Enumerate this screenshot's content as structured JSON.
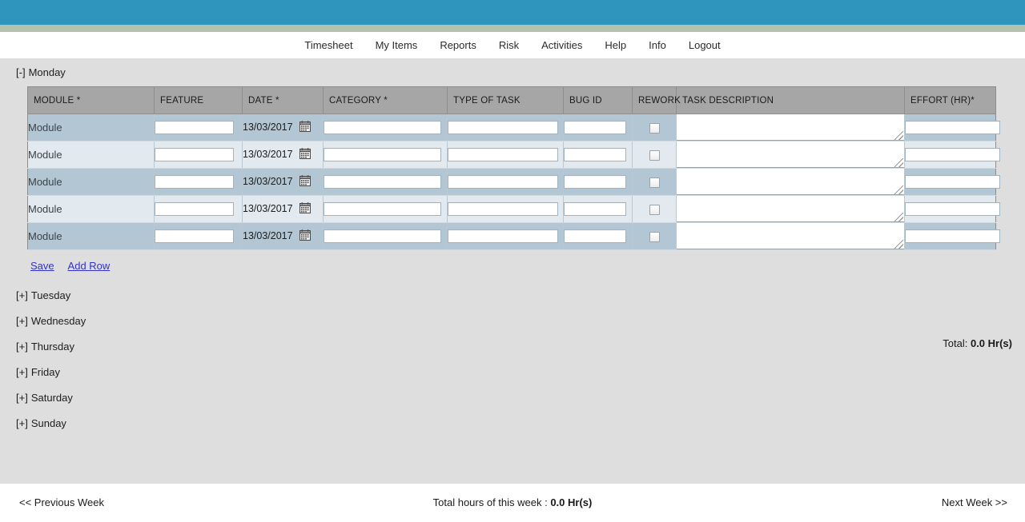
{
  "theme": {
    "banner_color": "#2f95bd",
    "banner_strip_color": "#b4c2ae",
    "content_bg": "#dedede",
    "header_row_bg": "#a6a6a6",
    "row_odd_bg": "#b3c6d3",
    "row_even_bg": "#e2eaef",
    "link_color": "#3232c8"
  },
  "nav": {
    "items": [
      {
        "label": "Timesheet"
      },
      {
        "label": "My Items"
      },
      {
        "label": "Reports"
      },
      {
        "label": "Risk"
      },
      {
        "label": "Activities"
      },
      {
        "label": "Help"
      },
      {
        "label": "Info"
      },
      {
        "label": "Logout"
      }
    ]
  },
  "expanded_day": {
    "toggle": "[-]",
    "label": "Monday"
  },
  "table": {
    "columns": [
      {
        "label": "MODULE *"
      },
      {
        "label": "FEATURE"
      },
      {
        "label": "DATE *"
      },
      {
        "label": "CATEGORY *"
      },
      {
        "label": "TYPE OF TASK"
      },
      {
        "label": "BUG ID"
      },
      {
        "label": "REWORK"
      },
      {
        "label": "TASK DESCRIPTION"
      },
      {
        "label": "EFFORT (HR)*"
      }
    ],
    "rows": [
      {
        "module": "Module",
        "feature": "",
        "date": "13/03/2017",
        "category": "",
        "type_of_task": "",
        "bug_id": "",
        "rework": false,
        "task_description": "",
        "effort": ""
      },
      {
        "module": "Module",
        "feature": "",
        "date": "13/03/2017",
        "category": "",
        "type_of_task": "",
        "bug_id": "",
        "rework": false,
        "task_description": "",
        "effort": ""
      },
      {
        "module": "Module",
        "feature": "",
        "date": "13/03/2017",
        "category": "",
        "type_of_task": "",
        "bug_id": "",
        "rework": false,
        "task_description": "",
        "effort": ""
      },
      {
        "module": "Module",
        "feature": "",
        "date": "13/03/2017",
        "category": "",
        "type_of_task": "",
        "bug_id": "",
        "rework": false,
        "task_description": "",
        "effort": ""
      },
      {
        "module": "Module",
        "feature": "",
        "date": "13/03/2017",
        "category": "",
        "type_of_task": "",
        "bug_id": "",
        "rework": false,
        "task_description": "",
        "effort": ""
      }
    ]
  },
  "actions": {
    "save_label": "Save",
    "add_row_label": "Add Row"
  },
  "day_total": {
    "prefix": "Total: ",
    "value": "0.0 Hr(s)"
  },
  "collapsed_days": [
    {
      "toggle": "[+]",
      "label": "Tuesday"
    },
    {
      "toggle": "[+]",
      "label": "Wednesday"
    },
    {
      "toggle": "[+]",
      "label": "Thursday"
    },
    {
      "toggle": "[+]",
      "label": "Friday"
    },
    {
      "toggle": "[+]",
      "label": "Saturday"
    },
    {
      "toggle": "[+]",
      "label": "Sunday"
    }
  ],
  "footer": {
    "previous_week": "<< Previous Week",
    "week_total_prefix": "Total hours of this week : ",
    "week_total_value": "0.0 Hr(s)",
    "next_week": "Next Week >>"
  }
}
